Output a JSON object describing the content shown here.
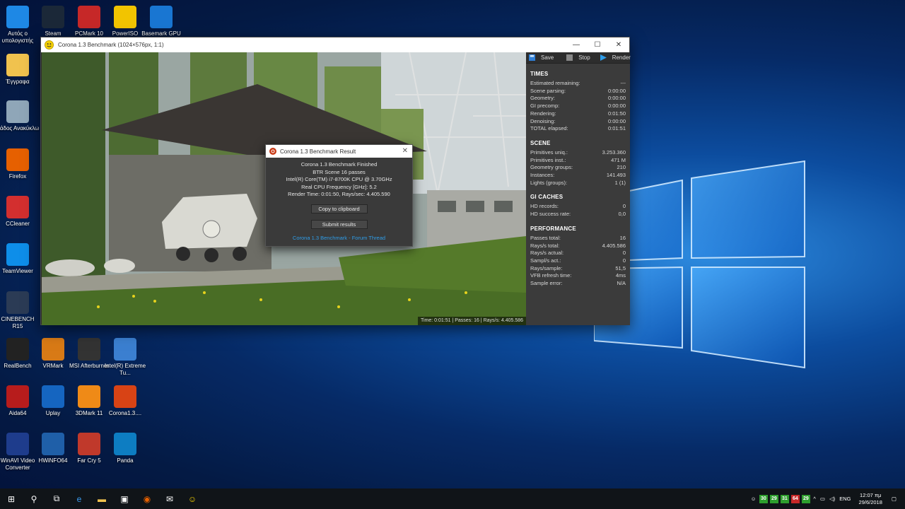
{
  "desktop_icons": [
    {
      "label": "Αυτός ο υπολογιστής",
      "icon": "this-pc-icon",
      "color": "#1e88e5"
    },
    {
      "label": "Steam",
      "icon": "steam-icon",
      "color": "#1b2838"
    },
    {
      "label": "PCMark 10",
      "icon": "pcmark-icon",
      "color": "#c62828"
    },
    {
      "label": "PowerISO",
      "icon": "poweriso-icon",
      "color": "#f2c400"
    },
    {
      "label": "Basemark GPU",
      "icon": "basemark-icon",
      "color": "#1976d2"
    },
    {
      "label": "Έγγραφα",
      "icon": "documents-folder-icon",
      "color": "#f0c24e"
    },
    {
      "label": "Κάδος Ανακύκλω",
      "icon": "recycle-bin-icon",
      "color": "#8fa6b8"
    },
    {
      "label": "Firefox",
      "icon": "firefox-icon",
      "color": "#e66000"
    },
    {
      "label": "CCleaner",
      "icon": "ccleaner-icon",
      "color": "#d32f2f"
    },
    {
      "label": "TeamViewer",
      "icon": "teamviewer-icon",
      "color": "#0e8ee9"
    },
    {
      "label": "CINEBENCH R15",
      "icon": "cinebench-icon",
      "color": "#2b3b55"
    },
    {
      "label": "RealBench",
      "icon": "realbench-icon",
      "color": "#222"
    },
    {
      "label": "VRMark",
      "icon": "vrmark-icon",
      "color": "#d87a16"
    },
    {
      "label": "MSI Afterburner",
      "icon": "afterburner-icon",
      "color": "#333"
    },
    {
      "label": "Intel(R) Extreme Tu...",
      "icon": "intel-xtu-icon",
      "color": "#3b7fd0"
    },
    {
      "label": "Aida64",
      "icon": "aida64-icon",
      "color": "#b71c1c"
    },
    {
      "label": "Uplay",
      "icon": "uplay-icon",
      "color": "#1565c0"
    },
    {
      "label": "3DMark 11",
      "icon": "3dmark-icon",
      "color": "#ef8a17"
    },
    {
      "label": "Corona1.3....",
      "icon": "corona-icon",
      "color": "#d84315"
    },
    {
      "label": "WinAVI Video Converter",
      "icon": "winavi-icon",
      "color": "#1e3c8c"
    },
    {
      "label": "HWiNFO64",
      "icon": "hwinfo-icon",
      "color": "#1f5fa8"
    },
    {
      "label": "Far Cry 5",
      "icon": "farcry-icon",
      "color": "#c0392b"
    },
    {
      "label": "Panda",
      "icon": "panda-icon",
      "color": "#0d7dc2"
    }
  ],
  "window": {
    "title": "Corona 1.3 Benchmark (1024×576px, 1:1)",
    "minimize": "—",
    "maximize": "☐",
    "close": "✕",
    "status_bar": "Time: 0:01:51 | Passes: 16 | Rays/s: 4.405.586"
  },
  "toolbar": {
    "save": "Save",
    "stop": "Stop",
    "render": "Render"
  },
  "times": {
    "title": "TIMES",
    "rows": [
      {
        "label": "Estimated remaining:",
        "value": "---"
      },
      {
        "label": "Scene parsing:",
        "value": "0:00:00"
      },
      {
        "label": "Geometry:",
        "value": "0:00:00"
      },
      {
        "label": "GI precomp:",
        "value": "0:00:00"
      },
      {
        "label": "Rendering:",
        "value": "0:01:50"
      },
      {
        "label": "Denoising:",
        "value": "0:00:00"
      },
      {
        "label": "TOTAL elapsed:",
        "value": "0:01:51"
      }
    ]
  },
  "scene": {
    "title": "SCENE",
    "rows": [
      {
        "label": "Primitives uniq.:",
        "value": "3.253.360"
      },
      {
        "label": "Primitives inst.:",
        "value": "471 M"
      },
      {
        "label": "Geometry groups:",
        "value": "210"
      },
      {
        "label": "Instances:",
        "value": "141.493"
      },
      {
        "label": "Lights (groups):",
        "value": "1 (1)"
      }
    ]
  },
  "gi_caches": {
    "title": "GI CACHES",
    "rows": [
      {
        "label": "HD records:",
        "value": "0"
      },
      {
        "label": "HD success rate:",
        "value": "0,0"
      }
    ]
  },
  "performance": {
    "title": "PERFORMANCE",
    "rows": [
      {
        "label": "Passes total:",
        "value": "16"
      },
      {
        "label": "Rays/s total:",
        "value": "4.405.586"
      },
      {
        "label": "Rays/s actual:",
        "value": "0"
      },
      {
        "label": "Sampl/s act.:",
        "value": "0"
      },
      {
        "label": "Rays/sample:",
        "value": "51,5"
      },
      {
        "label": "VFB refresh time:",
        "value": "4ms"
      },
      {
        "label": "Sample error:",
        "value": "N/A"
      }
    ]
  },
  "dialog": {
    "title": "Corona 1.3 Benchmark Result",
    "lines": [
      "Corona 1.3 Benchmark Finished",
      "BTR Scene 16 passes",
      "Intel(R) Core(TM) i7-8700K CPU @ 3.70GHz",
      "Real CPU Frequency [GHz]: 5.2",
      "Render Time: 0:01:50, Rays/sec: 4.405.590"
    ],
    "copy_button": "Copy to clipboard",
    "submit_button": "Submit results",
    "forum_link": "Corona 1.3 Benchmark - Forum Thread"
  },
  "taskbar": {
    "apps": [
      "start-icon",
      "search-icon",
      "task-view-icon",
      "edge-icon",
      "file-explorer-icon",
      "store-icon",
      "firefox-icon",
      "mail-icon",
      "corona-icon"
    ],
    "tray_numbers": [
      {
        "value": "30",
        "color": "#2e9e2e"
      },
      {
        "value": "29",
        "color": "#2e9e2e"
      },
      {
        "value": "31",
        "color": "#2e9e2e"
      },
      {
        "value": "64",
        "color": "#c62828"
      },
      {
        "value": "29",
        "color": "#2e9e2e"
      }
    ],
    "language": "ENG",
    "time": "12:07 πμ",
    "date": "29/6/2018"
  }
}
